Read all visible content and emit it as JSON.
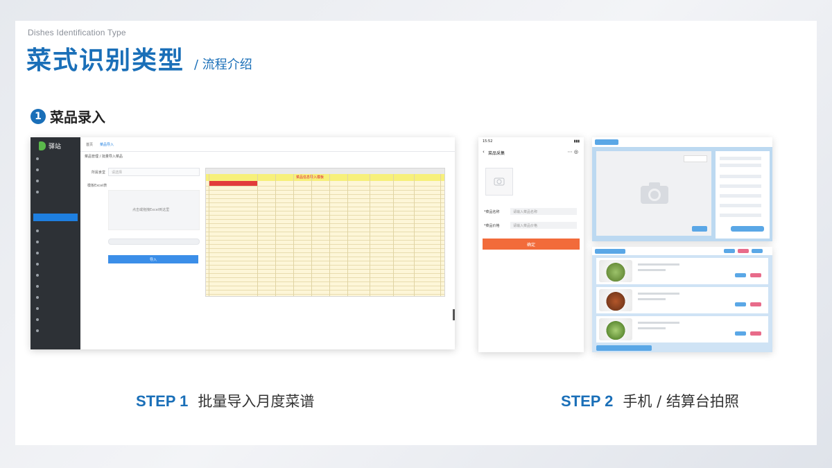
{
  "header": {
    "subtitle_en": "Dishes Identification Type",
    "title": "菜式识别类型",
    "subtitle": "/ 流程介绍"
  },
  "section": {
    "number": "1",
    "title": "菜品录入"
  },
  "step1": {
    "label": "STEP 1",
    "text": "批量导入月度菜谱",
    "screen": {
      "logo": "驿站",
      "tab_home": "首页",
      "tab_active": "菜品导入",
      "breadcrumb": "菜品管理 / 批量导入菜品",
      "form_label_1": "所属食堂",
      "form_placeholder_1": "请选择",
      "form_label_2": "模板Excel表",
      "upload_hint": "点击或拖拽Excel到这里",
      "import_button": "导入",
      "sheet_title": "菜品信息导入模板"
    }
  },
  "step2": {
    "label": "STEP 2",
    "text": "手机 / 结算台拍照",
    "phone": {
      "status_time": "15:52",
      "title": "菜品采集",
      "field_1": "*菜品名称",
      "field_1_placeholder": "请输入菜品名称",
      "field_2": "*菜品价格",
      "field_2_placeholder": "请输入菜品价格",
      "confirm_button": "确定"
    }
  },
  "colors": {
    "accent": "#1a6fb8",
    "orange": "#f26b3a",
    "sidebar": "#2d3136"
  }
}
